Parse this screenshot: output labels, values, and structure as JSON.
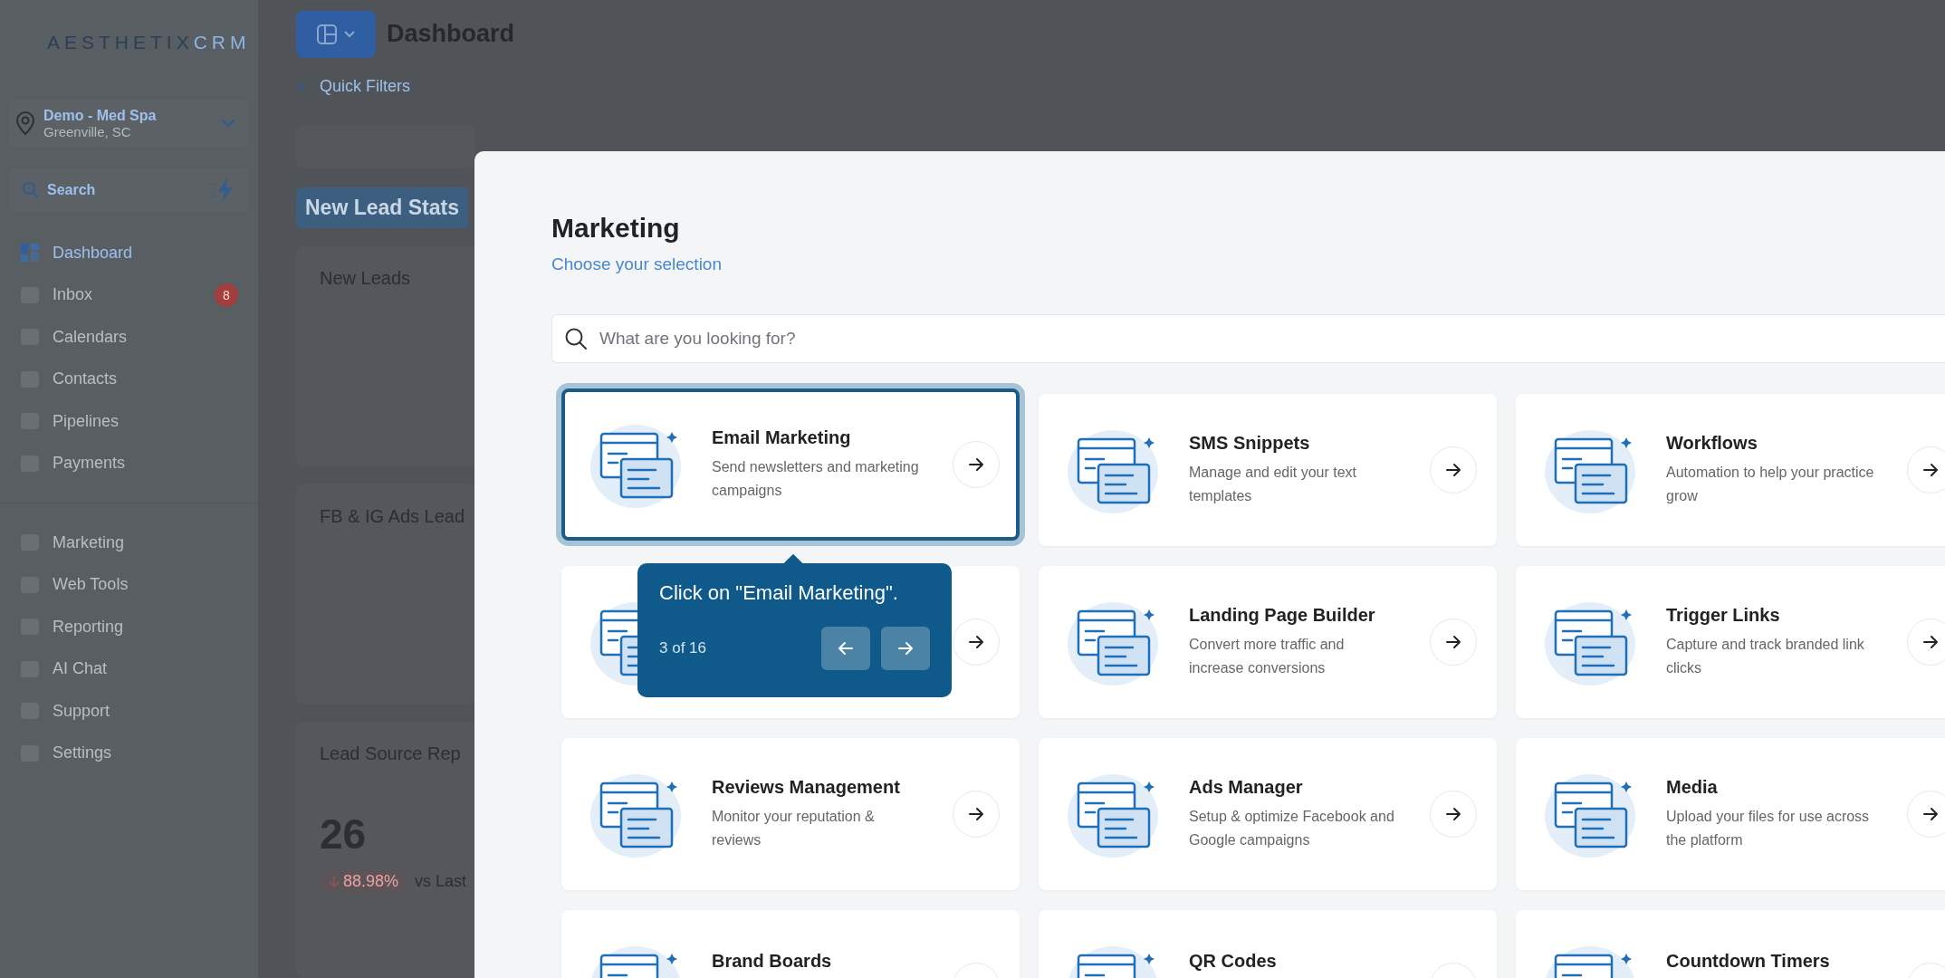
{
  "sidebar": {
    "logo": {
      "main": "AESTHETIX",
      "accent": "CRM"
    },
    "location": {
      "name": "Demo - Med Spa",
      "city": "Greenville, SC"
    },
    "search": {
      "label": "Search"
    },
    "items": [
      {
        "label": "Dashboard",
        "selected": true
      },
      {
        "label": "Inbox",
        "selected": false,
        "badge": "8"
      },
      {
        "label": "Calendars",
        "selected": false
      },
      {
        "label": "Contacts",
        "selected": false
      },
      {
        "label": "Pipelines",
        "selected": false
      },
      {
        "label": "Payments",
        "selected": false
      }
    ],
    "items_secondary": [
      {
        "label": "Marketing",
        "selected": false
      },
      {
        "label": "Web Tools",
        "selected": false
      },
      {
        "label": "Reporting",
        "selected": false
      },
      {
        "label": "AI Chat",
        "selected": false
      },
      {
        "label": "Support",
        "selected": false
      },
      {
        "label": "Settings",
        "selected": false
      }
    ]
  },
  "header": {
    "title": "Dashboard",
    "quick_filters": "Quick Filters"
  },
  "dashboard": {
    "section_label": "New Lead Stats",
    "cards": [
      {
        "title": "New Leads"
      },
      {
        "title": "FB & IG Ads Lead"
      },
      {
        "title": "Lead Source Rep",
        "value": "26",
        "change": "88.98%",
        "comparison": "vs Last"
      }
    ]
  },
  "modal": {
    "title": "Marketing",
    "subtitle": "Choose your selection",
    "search": {
      "placeholder": "What are you looking for?"
    },
    "cards": [
      {
        "title": "Email Marketing",
        "description": "Send newsletters and marketing campaigns",
        "selected": true
      },
      {
        "title": "SMS Snippets",
        "description": "Manage and edit your text templates",
        "selected": false
      },
      {
        "title": "Workflows",
        "description": "Automation to help your practice grow",
        "selected": false
      },
      {
        "selected": false
      },
      {
        "title": "Landing Page Builder",
        "description": "Convert more traffic and increase conversions",
        "selected": false
      },
      {
        "title": "Trigger Links",
        "description": "Capture and track branded link clicks",
        "selected": false
      },
      {
        "title": "Reviews Management",
        "description": "Monitor your reputation & reviews",
        "selected": false
      },
      {
        "title": "Ads Manager",
        "description": "Setup & optimize Facebook and Google campaigns",
        "selected": false
      },
      {
        "title": "Media",
        "description": "Upload your files for use across the platform",
        "selected": false
      },
      {
        "title": "Brand Boards",
        "selected": false
      },
      {
        "title": "QR Codes",
        "selected": false
      },
      {
        "title": "Countdown Timers",
        "selected": false
      }
    ]
  },
  "tooltip": {
    "text": "Click on \"Email Marketing\".",
    "progress": "3 of 16"
  }
}
